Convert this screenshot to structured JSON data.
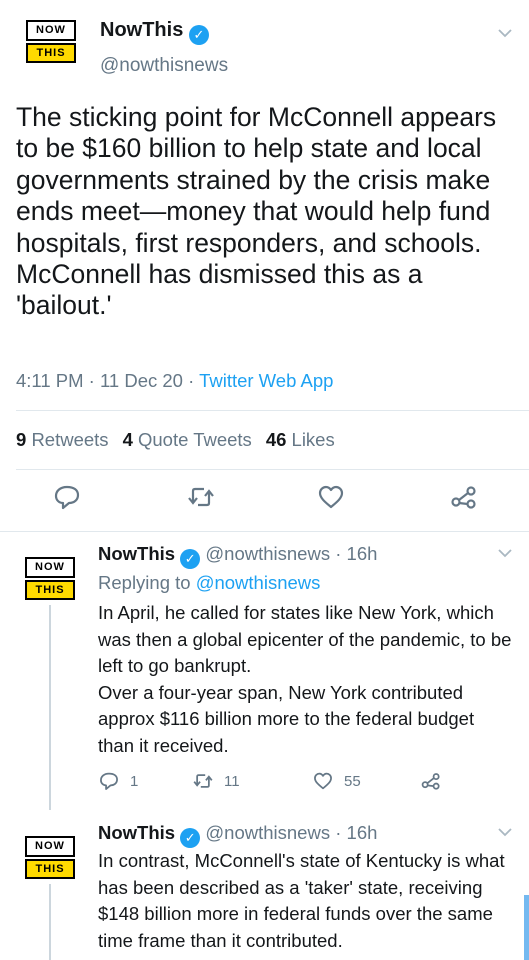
{
  "logo": {
    "top": "NOW",
    "bottom": "THIS"
  },
  "main": {
    "name": "NowThis",
    "handle": "@nowthisnews",
    "text": "The sticking point for McConnell appears to be $160 billion to help state and local governments strained by the crisis make ends meet—money that would help fund hospitals, first responders, and schools. McConnell has dismissed this as a 'bailout.'",
    "time": "4:11 PM",
    "date": "11 Dec 20",
    "source": "Twitter Web App",
    "retweets_count": "9",
    "retweets_label": "Retweets",
    "quotes_count": "4",
    "quotes_label": "Quote Tweets",
    "likes_count": "46",
    "likes_label": "Likes"
  },
  "replies": [
    {
      "name": "NowThis",
      "handle": "@nowthisnews",
      "age": "16h",
      "replying_label": "Replying to",
      "replying_to": "@nowthisnews",
      "text": "In April, he called for states like New York, which was then a global epicenter of the pandemic, to be left to go bankrupt.\nOver a four-year span, New York contributed approx $116 billion more to the federal budget than it received.",
      "replies": "1",
      "retweets": "11",
      "likes": "55"
    },
    {
      "name": "NowThis",
      "handle": "@nowthisnews",
      "age": "16h",
      "text": "In contrast, McConnell's state of Kentucky is what has been described as a 'taker' state, receiving $148 billion more in federal funds over the same time frame than it contributed."
    }
  ],
  "icons": {
    "verified": "verified-badge-icon",
    "chevron": "chevron-down-icon",
    "reply": "reply-icon",
    "retweet": "retweet-icon",
    "like": "heart-icon",
    "share": "share-icon"
  },
  "colors": {
    "accent": "#1da1f2",
    "muted": "#657786",
    "logo_yellow": "#ffda00"
  }
}
